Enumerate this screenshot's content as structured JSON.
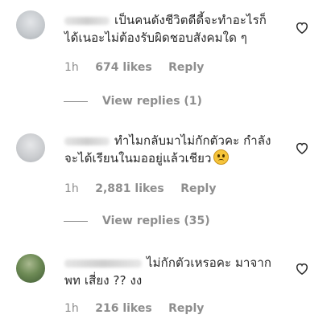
{
  "comments": [
    {
      "text": "เป็นคนดังชีวิตดีดี้จะทำอะไรก็ได้เนอะไม่ต้องรับผิดชอบสังคมใด ๆ",
      "time": "1h",
      "likes": "674 likes",
      "reply": "Reply",
      "view_replies": "View replies (1)",
      "avatar_color": "#bfc3c8"
    },
    {
      "text": "ทำไมกลับมาไม่กักตัวคะ กำลังจะได้เรียนในมออยู่แล้วเชียว",
      "time": "1h",
      "likes": "2,881 likes",
      "reply": "Reply",
      "view_replies": "View replies (35)",
      "avatar_color": "#c7c9cc"
    },
    {
      "text": "ไม่กักตัวเหรอคะ มาจาก พท เสี่ยง ?? งง",
      "time": "1h",
      "likes": "216 likes",
      "reply": "Reply",
      "avatar_color": "#5e7f4a"
    }
  ]
}
